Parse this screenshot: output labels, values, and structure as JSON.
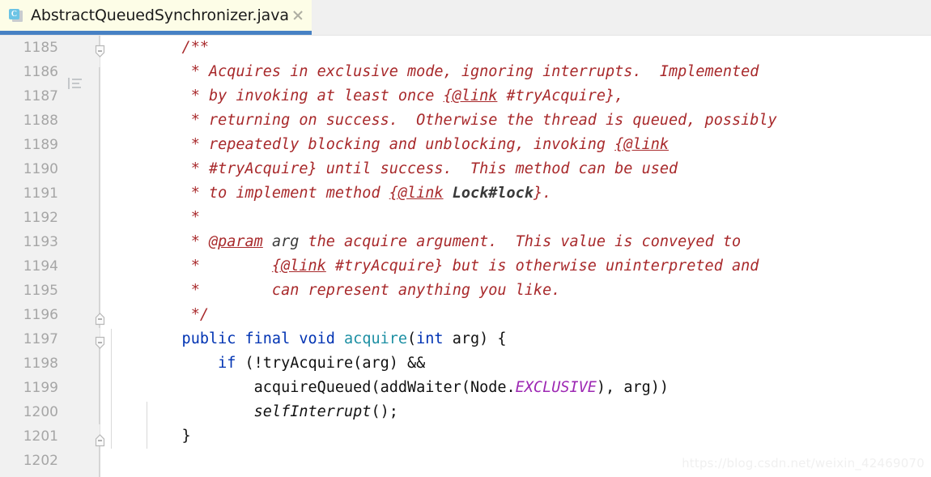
{
  "window": {
    "app": "IntelliJ IDEA Editor",
    "background_color": "#ffffff"
  },
  "tabbar": {
    "background_color": "#f0f0f0",
    "active_tab": {
      "title": "AbstractQueuedSynchronizer.java",
      "icon": "java-class-icon",
      "icon_letter": "C",
      "background_color": "#fdfde7",
      "underline_color": "#4781c4",
      "close_icon": "close-icon"
    }
  },
  "gutter": {
    "background_color": "#f1f1f1",
    "line_numbers": [
      "1185",
      "1186",
      "1187",
      "1188",
      "1189",
      "1190",
      "1191",
      "1192",
      "1193",
      "1194",
      "1195",
      "1196",
      "1197",
      "1198",
      "1199",
      "1200",
      "1201",
      "1202"
    ],
    "icons": [
      {
        "name": "indent-lines-icon",
        "line": "1185"
      }
    ],
    "fold_markers": [
      {
        "name": "fold-end-marker",
        "line": "1185",
        "direction": "down"
      },
      {
        "name": "fold-end-marker",
        "line": "1196",
        "direction": "up"
      },
      {
        "name": "fold-start-marker",
        "line": "1197",
        "direction": "down"
      },
      {
        "name": "fold-end-marker",
        "line": "1201",
        "direction": "up"
      }
    ]
  },
  "editor": {
    "language": "java",
    "font_size_px": 18.5,
    "line_height_px": 30,
    "colors": {
      "javadoc": "#a8292b",
      "keyword": "#0033b3",
      "method_declaration": "#1c8fa3",
      "static_field": "#9d28b3",
      "plain_text": "#111111"
    },
    "lines": [
      {
        "number": "1185",
        "tokens": [
          {
            "cls": "doc",
            "text": "    /**"
          }
        ]
      },
      {
        "number": "1186",
        "tokens": [
          {
            "cls": "doc",
            "text": "     * Acquires in exclusive mode, ignoring interrupts.  Implemented"
          }
        ]
      },
      {
        "number": "1187",
        "tokens": [
          {
            "cls": "doc",
            "text": "     * by invoking at least once "
          },
          {
            "cls": "doc-tag",
            "text": "{@link"
          },
          {
            "cls": "doc",
            "text": " #tryAcquire},"
          }
        ]
      },
      {
        "number": "1188",
        "tokens": [
          {
            "cls": "doc",
            "text": "     * returning on success.  Otherwise the thread is queued, possibly"
          }
        ]
      },
      {
        "number": "1189",
        "tokens": [
          {
            "cls": "doc",
            "text": "     * repeatedly blocking and unblocking, invoking "
          },
          {
            "cls": "doc-tag",
            "text": "{@link"
          }
        ]
      },
      {
        "number": "1190",
        "tokens": [
          {
            "cls": "doc",
            "text": "     * #tryAcquire} until success.  This method can be used"
          }
        ]
      },
      {
        "number": "1191",
        "tokens": [
          {
            "cls": "doc",
            "text": "     * to implement method "
          },
          {
            "cls": "doc-tag",
            "text": "{@link"
          },
          {
            "cls": "doc",
            "text": " "
          },
          {
            "cls": "doc-val",
            "text": "Lock#lock"
          },
          {
            "cls": "doc",
            "text": "}."
          }
        ]
      },
      {
        "number": "1192",
        "tokens": [
          {
            "cls": "doc",
            "text": "     *"
          }
        ]
      },
      {
        "number": "1193",
        "tokens": [
          {
            "cls": "doc",
            "text": "     * "
          },
          {
            "cls": "doc-tag",
            "text": "@param"
          },
          {
            "cls": "doc",
            "text": " "
          },
          {
            "cls": "doc-param",
            "text": "arg"
          },
          {
            "cls": "doc",
            "text": " the acquire argument.  This value is conveyed to"
          }
        ]
      },
      {
        "number": "1194",
        "tokens": [
          {
            "cls": "doc",
            "text": "     *        "
          },
          {
            "cls": "doc-tag",
            "text": "{@link"
          },
          {
            "cls": "doc",
            "text": " #tryAcquire} but is otherwise uninterpreted and"
          }
        ]
      },
      {
        "number": "1195",
        "tokens": [
          {
            "cls": "doc",
            "text": "     *        can represent anything you like."
          }
        ]
      },
      {
        "number": "1196",
        "tokens": [
          {
            "cls": "doc",
            "text": "     */"
          }
        ]
      },
      {
        "number": "1197",
        "tokens": [
          {
            "cls": "kw",
            "text": "    public final void "
          },
          {
            "cls": "mdecl",
            "text": "acquire"
          },
          {
            "cls": "plain",
            "text": "("
          },
          {
            "cls": "kw",
            "text": "int"
          },
          {
            "cls": "plain",
            "text": " arg) {"
          }
        ]
      },
      {
        "number": "1198",
        "tokens": [
          {
            "cls": "plain",
            "text": "        "
          },
          {
            "cls": "kw",
            "text": "if"
          },
          {
            "cls": "plain",
            "text": " (!tryAcquire(arg) &&"
          }
        ]
      },
      {
        "number": "1199",
        "tokens": [
          {
            "cls": "plain",
            "text": "            acquireQueued(addWaiter(Node."
          },
          {
            "cls": "statfld",
            "text": "EXCLUSIVE"
          },
          {
            "cls": "plain",
            "text": "), arg))"
          }
        ]
      },
      {
        "number": "1200",
        "tokens": [
          {
            "cls": "plain",
            "text": "            "
          },
          {
            "cls": "statmeth",
            "text": "selfInterrupt"
          },
          {
            "cls": "plain",
            "text": "();"
          }
        ]
      },
      {
        "number": "1201",
        "tokens": [
          {
            "cls": "plain",
            "text": "    }"
          }
        ]
      },
      {
        "number": "1202",
        "tokens": [
          {
            "cls": "plain",
            "text": ""
          }
        ]
      }
    ]
  },
  "watermark": {
    "text": "https://blog.csdn.net/weixin_42469070"
  }
}
